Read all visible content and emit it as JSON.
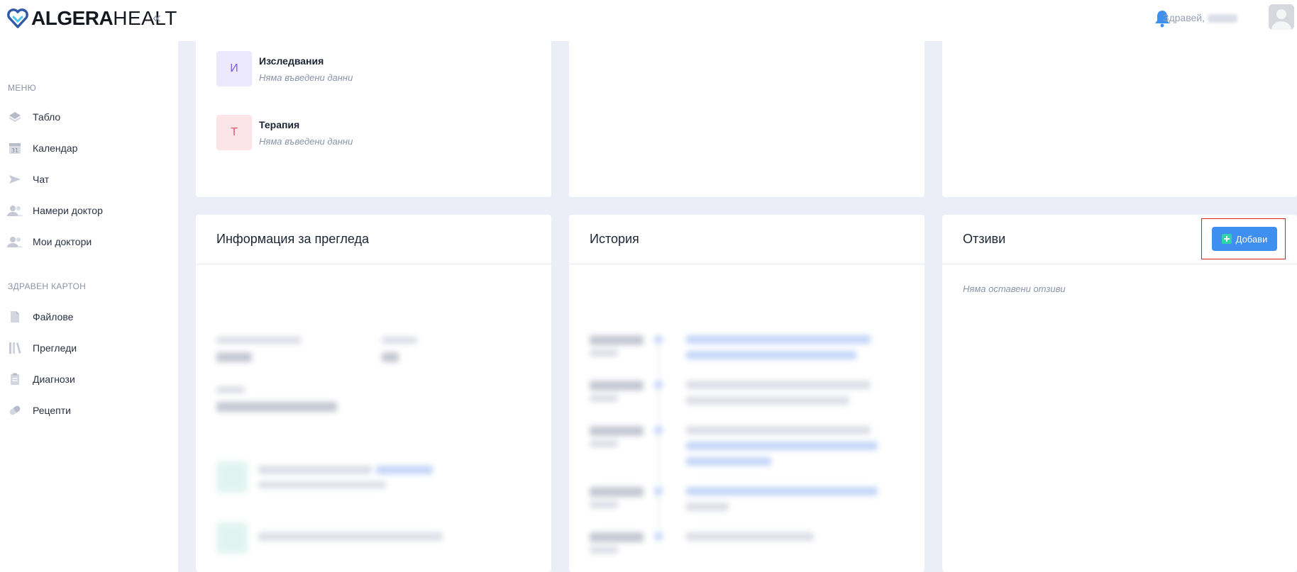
{
  "brand": {
    "name_bold": "ALGERA",
    "name_light": "HEALTH",
    "collapse_icon": "double-chevron-left-icon"
  },
  "sidebar": {
    "section_menu": "МЕНЮ",
    "items": [
      {
        "label": "Табло",
        "icon": "dashboard-icon"
      },
      {
        "label": "Календар",
        "icon": "calendar-icon"
      },
      {
        "label": "Чат",
        "icon": "send-icon"
      },
      {
        "label": "Намери доктор",
        "icon": "users-icon"
      },
      {
        "label": "Мои доктори",
        "icon": "users-icon"
      }
    ],
    "section_health": "ЗДРАВЕН КАРТОН",
    "health_items": [
      {
        "label": "Файлове",
        "icon": "file-icon"
      },
      {
        "label": "Прегледи",
        "icon": "library-icon"
      },
      {
        "label": "Диагнози",
        "icon": "clipboard-icon"
      },
      {
        "label": "Рецепти",
        "icon": "pill-icon"
      }
    ]
  },
  "topbar": {
    "greeting": "Здравей,",
    "bell_icon": "bell-icon",
    "avatar_icon": "user-avatar-icon"
  },
  "top_card": {
    "items": [
      {
        "letter": "И",
        "title": "Изследвания",
        "subtitle": "Няма въведени данни",
        "bg": "#ece9fd",
        "fg": "#7c5ce8"
      },
      {
        "letter": "Т",
        "title": "Терапия",
        "subtitle": "Няма въведени данни",
        "bg": "#fde4e8",
        "fg": "#e8556b"
      }
    ]
  },
  "info_card": {
    "title": "Информация за прегледа"
  },
  "history_card": {
    "title": "История"
  },
  "reviews_card": {
    "title": "Отзиви",
    "add_label": "Добави",
    "empty_text": "Няма оставени отзиви"
  },
  "colors": {
    "accent": "#3e8ff0",
    "add_plus": "#2fd3a7",
    "highlight": "#e02020"
  }
}
